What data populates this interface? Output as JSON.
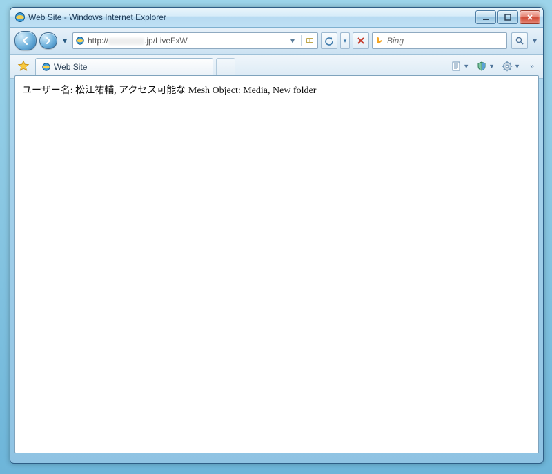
{
  "window": {
    "title": "Web Site - Windows Internet Explorer",
    "controls": {
      "minimize": "minimize",
      "maximize": "maximize",
      "close": "close"
    }
  },
  "nav": {
    "address_prefix": "http://",
    "address_hidden": "███",
    "address_suffix": ".jp/LiveFxW"
  },
  "search": {
    "engine": "Bing"
  },
  "tabs": {
    "active_label": "Web Site"
  },
  "page": {
    "body_text": "ユーザー名: 松江祐輔, アクセス可能な Mesh Object: Media, New folder"
  },
  "icons": {
    "app": "ie-icon",
    "favorites": "star-icon",
    "page": "page-icon",
    "safety": "shield-icon",
    "tools": "gear-icon",
    "bing": "bing-icon",
    "search": "search-icon",
    "refresh": "refresh-icon",
    "stop": "stop-icon",
    "compat": "compat-icon"
  }
}
